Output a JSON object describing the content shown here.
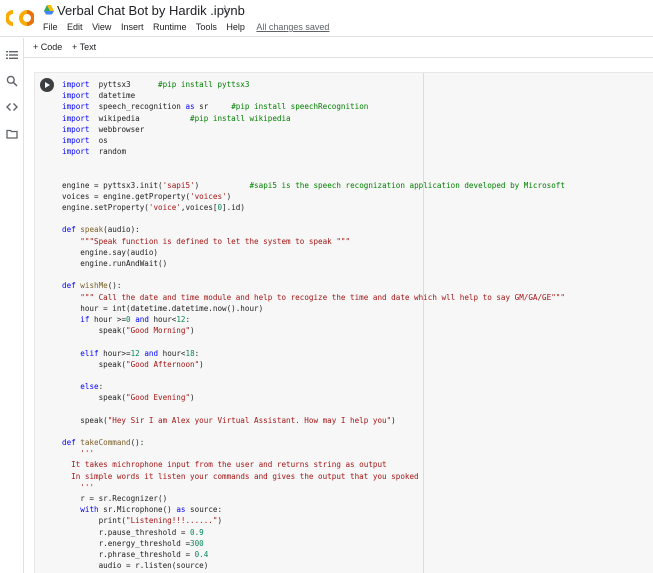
{
  "header": {
    "title": "Verbal Chat Bot by Hardik .ipynb",
    "menu": [
      "File",
      "Edit",
      "View",
      "Insert",
      "Runtime",
      "Tools",
      "Help"
    ],
    "save_status": "All changes saved",
    "logo": "colab-logo",
    "colors": {
      "logo_orange": "#f9ab00",
      "logo_dark": "#e8710a"
    }
  },
  "toolbar": {
    "add_code": "+ Code",
    "add_text": "+ Text"
  },
  "rail": {
    "icons": [
      "list-icon",
      "search-icon",
      "code-icon",
      "folder-icon"
    ]
  },
  "code_lines": [
    [
      [
        "kw",
        "import"
      ],
      [
        "",
        "  pyttsx3      "
      ],
      [
        "cm",
        "#pip install pyttsx3"
      ]
    ],
    [
      [
        "kw",
        "import"
      ],
      [
        "",
        "  datetime"
      ]
    ],
    [
      [
        "kw",
        "import"
      ],
      [
        "",
        "  speech_recognition "
      ],
      [
        "kw",
        "as"
      ],
      [
        "",
        " sr     "
      ],
      [
        "cm",
        "#pip install speechRecognition"
      ]
    ],
    [
      [
        "kw",
        "import"
      ],
      [
        "",
        "  wikipedia           "
      ],
      [
        "cm",
        "#pip install wikipedia"
      ]
    ],
    [
      [
        "kw",
        "import"
      ],
      [
        "",
        "  webbrowser"
      ]
    ],
    [
      [
        "kw",
        "import"
      ],
      [
        "",
        "  os"
      ]
    ],
    [
      [
        "kw",
        "import"
      ],
      [
        "",
        "  random"
      ]
    ],
    [],
    [],
    [
      [
        "",
        "engine = pyttsx3.init("
      ],
      [
        "st",
        "'sapi5'"
      ],
      [
        "",
        ")           "
      ],
      [
        "cm",
        "#sapi5 is the speech recognization application developed by Microsoft"
      ]
    ],
    [
      [
        "",
        "voices = engine.getProperty("
      ],
      [
        "st",
        "'voices'"
      ],
      [
        "",
        ")"
      ]
    ],
    [
      [
        "",
        "engine.setProperty("
      ],
      [
        "st",
        "'voice'"
      ],
      [
        "",
        ",voices["
      ],
      [
        "nm",
        "0"
      ],
      [
        "",
        "].id)"
      ]
    ],
    [],
    [
      [
        "kw",
        "def"
      ],
      [
        "",
        " "
      ],
      [
        "fn",
        "speak"
      ],
      [
        "",
        "(audio):"
      ]
    ],
    [
      [
        "",
        "    "
      ],
      [
        "st",
        "\"\"\"Speak function is defined to let the system to speak \"\"\""
      ]
    ],
    [
      [
        "",
        "    engine.say(audio)"
      ]
    ],
    [
      [
        "",
        "    engine.runAndWait()"
      ]
    ],
    [],
    [
      [
        "kw",
        "def"
      ],
      [
        "",
        " "
      ],
      [
        "fn",
        "wishMe"
      ],
      [
        "",
        "():"
      ]
    ],
    [
      [
        "",
        "    "
      ],
      [
        "st",
        "\"\"\" Call the date and time module and help to recogize the time and date which wll help to say GM/GA/GE\"\"\""
      ]
    ],
    [
      [
        "",
        "    hour = int(datetime.datetime.now().hour)"
      ]
    ],
    [
      [
        "",
        "    "
      ],
      [
        "kw",
        "if"
      ],
      [
        "",
        " hour >="
      ],
      [
        "nm",
        "0"
      ],
      [
        "",
        " "
      ],
      [
        "kw",
        "and"
      ],
      [
        "",
        " hour<"
      ],
      [
        "nm",
        "12"
      ],
      [
        "",
        ":"
      ]
    ],
    [
      [
        "",
        "        speak("
      ],
      [
        "st",
        "\"Good Morning\""
      ],
      [
        "",
        ")"
      ]
    ],
    [],
    [
      [
        "",
        "    "
      ],
      [
        "kw",
        "elif"
      ],
      [
        "",
        " hour>="
      ],
      [
        "nm",
        "12"
      ],
      [
        "",
        " "
      ],
      [
        "kw",
        "and"
      ],
      [
        "",
        " hour<"
      ],
      [
        "nm",
        "18"
      ],
      [
        "",
        ":"
      ]
    ],
    [
      [
        "",
        "        speak("
      ],
      [
        "st",
        "\"Good Afternoon\""
      ],
      [
        "",
        ")"
      ]
    ],
    [],
    [
      [
        "",
        "    "
      ],
      [
        "kw",
        "else"
      ],
      [
        "",
        ":"
      ]
    ],
    [
      [
        "",
        "        speak("
      ],
      [
        "st",
        "\"Good Evening\""
      ],
      [
        "",
        ")"
      ]
    ],
    [],
    [
      [
        "",
        "    speak("
      ],
      [
        "st",
        "\"Hey Sir I am Alex your Virtual Assistant. How may I help you\""
      ],
      [
        "",
        ")"
      ]
    ],
    [],
    [
      [
        "kw",
        "def"
      ],
      [
        "",
        " "
      ],
      [
        "fn",
        "takeCommand"
      ],
      [
        "",
        "():"
      ]
    ],
    [
      [
        "",
        "    "
      ],
      [
        "st",
        "'''"
      ]
    ],
    [
      [
        "",
        "  "
      ],
      [
        "st",
        "It takes michrophone input from the user and returns string as output"
      ]
    ],
    [
      [
        "",
        "  "
      ],
      [
        "st",
        "In simple words it listen your commands and gives the output that you spoked"
      ]
    ],
    [
      [
        "",
        "    "
      ],
      [
        "st",
        "'''"
      ]
    ],
    [
      [
        "",
        "    r = sr.Recognizer()"
      ]
    ],
    [
      [
        "",
        "    "
      ],
      [
        "kw",
        "with"
      ],
      [
        "",
        " sr.Microphone() "
      ],
      [
        "kw",
        "as"
      ],
      [
        "",
        " source:"
      ]
    ],
    [
      [
        "",
        "        print("
      ],
      [
        "st",
        "\"Listening!!!......\""
      ],
      [
        "",
        ")"
      ]
    ],
    [
      [
        "",
        "        r.pause_threshold = "
      ],
      [
        "nm",
        "0.9"
      ]
    ],
    [
      [
        "",
        "        r.energy_threshold ="
      ],
      [
        "nm",
        "300"
      ]
    ],
    [
      [
        "",
        "        r.phrase_threshold = "
      ],
      [
        "nm",
        "0.4"
      ]
    ],
    [
      [
        "",
        "        audio = r.listen(source)"
      ]
    ]
  ]
}
